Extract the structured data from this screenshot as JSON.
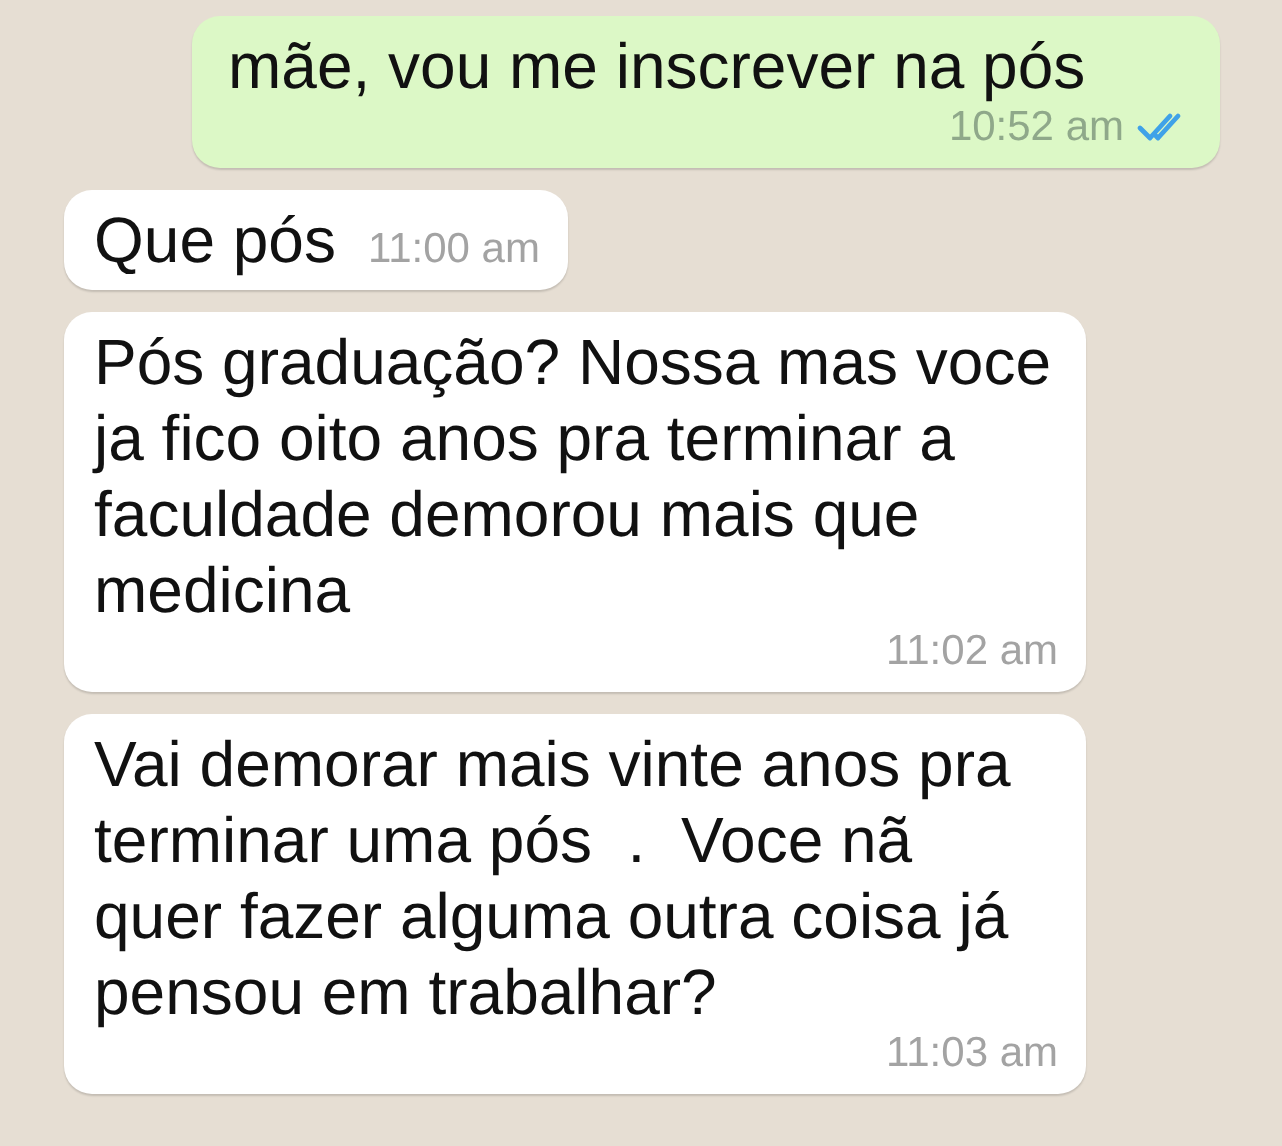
{
  "messages": [
    {
      "kind": "sent",
      "text": "mãe, vou me inscrever na pós",
      "time": "10:52 am",
      "read": true
    },
    {
      "kind": "received",
      "text": "Que pós",
      "time": "11:00 am"
    },
    {
      "kind": "received",
      "text": "Pós graduação? Nossa mas voce ja fico oito anos pra terminar a faculdade demorou mais que medicina",
      "time": "11:02 am"
    },
    {
      "kind": "received",
      "text": "Vai demorar mais vinte anos pra terminar uma pós  .  Voce nã quer fazer alguma outra coisa já pensou em trabalhar?",
      "time": "11:03 am"
    }
  ]
}
